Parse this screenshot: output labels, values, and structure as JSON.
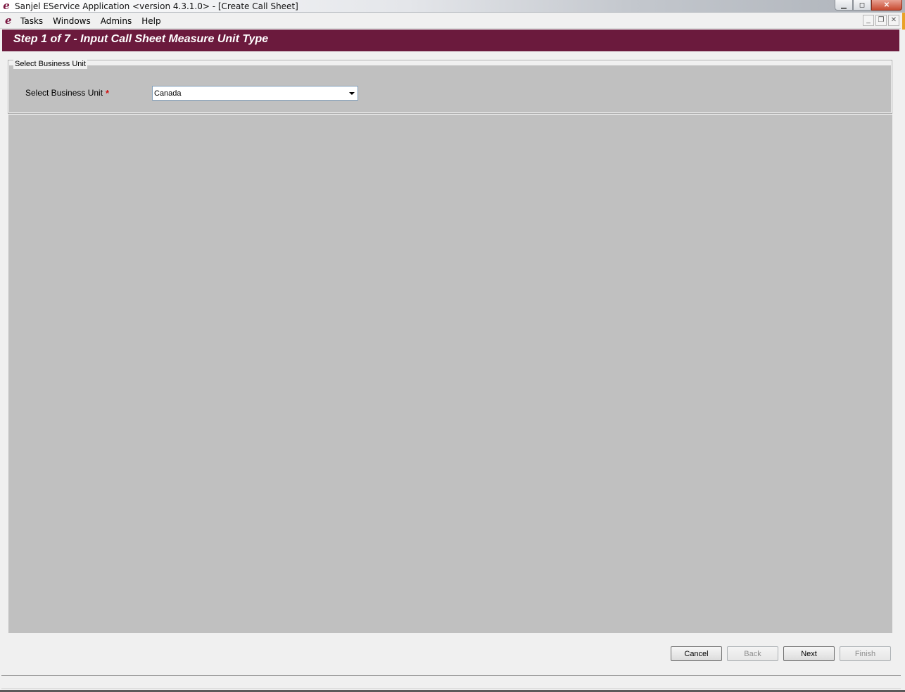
{
  "window": {
    "title": "Sanjel EService Application <version 4.3.1.0> - [Create Call Sheet]",
    "logo_glyph": "e",
    "minimize_glyph": "▁",
    "maximize_glyph": "◻",
    "close_glyph": "✕"
  },
  "menubar": {
    "logo_glyph": "e",
    "items": [
      {
        "label": "Tasks"
      },
      {
        "label": "Windows"
      },
      {
        "label": "Admins"
      },
      {
        "label": "Help"
      }
    ],
    "mdi_minimize_glyph": "_",
    "mdi_restore_glyph": "❐",
    "mdi_close_glyph": "✕"
  },
  "wizard": {
    "step_title": "Step 1 of 7 - Input Call Sheet Measure Unit Type",
    "group_legend": "Select Business Unit",
    "field_label": "Select Business Unit",
    "required_mark": "*",
    "business_unit_value": "Canada"
  },
  "buttons": {
    "cancel": "Cancel",
    "back": "Back",
    "next": "Next",
    "finish": "Finish"
  },
  "colors": {
    "header_bg": "#6b1a3d",
    "panel_bg": "#c0c0c0",
    "required": "#d01010",
    "accent": "#e9a227"
  }
}
